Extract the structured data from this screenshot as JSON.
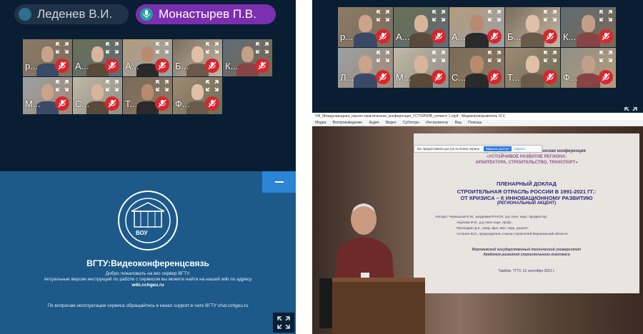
{
  "colors": {
    "panel_bg": "#0a1e33",
    "accent": "#2b84d6",
    "mute": "#d9262e",
    "pill_purple": "#7b2fb0",
    "welcome_bg": "#1d5a8a"
  },
  "speakers": [
    {
      "name": "Леденев В.И.",
      "state": "inactive",
      "icon": "dot-icon"
    },
    {
      "name": "Монастырев П.В.",
      "state": "speaking",
      "icon": "microphone-icon"
    }
  ],
  "left_tiles": [
    "р...",
    "А...",
    "А...",
    "Б...",
    "К...",
    "М...",
    "С...",
    "Т...",
    "Ф..."
  ],
  "right_tiles": [
    "р...",
    "А...",
    "А...",
    "Б...",
    "К...",
    "Л...",
    "М...",
    "С...",
    "Т...",
    "Ф..."
  ],
  "welcome": {
    "logo_top": "Воронежский опорный университет",
    "logo_abbr": "ВОУ",
    "title": "ВГТУ:Видеоконференцсвязь",
    "line1": "Добро пожаловать на вкс сервер ВГТУ.",
    "line2": "Актуальные версии инструкций по работе с сервисом вы можете найти на нашей wiki по адресу",
    "line3": "wiki.cchgeu.ru",
    "support": "По вопросам эксплуатации сервиса обращайтесь в канал support в чате ВГТУ chat.cchgeu.ru"
  },
  "vlc": {
    "title": "VIII_Международная_научно-практическая_конференция_УСТОЙЧИВ_сегмент 1.mp4 - Медиапроигрыватель VLC",
    "menu": [
      "Медиа",
      "Воспроизведение",
      "Аудио",
      "Видео",
      "Субтитры",
      "Инструменты",
      "Вид",
      "Помощь"
    ],
    "notice": "Вы предоставили доступ ко всему экрану",
    "notice_btn": "Закрыть доступ",
    "notice_x": "Скрыть"
  },
  "slide": {
    "l1": "VIII Международная научно-практическая конференция",
    "l2": "«УСТОЙЧИВОЕ РАЗВИТИЕ РЕГИОНА:",
    "l3": "АРХИТЕКТУРА, СТРОИТЕЛЬСТВО, ТРАНСПОРТ»",
    "l4": "ПЛЕНАРНЫЙ ДОКЛАД",
    "l5": "СТРОИТЕЛЬНАЯ ОТРАСЛЬ РОССИИ В 1991-2021 ГГ.:",
    "l6": "ОТ КРИЗИСА – К ИННОВАЦИОННОМУ РАЗВИТИЮ",
    "l7": "(РЕГИОНАЛЬНЫЙ АКЦЕНТ)",
    "a1": "Авторы:  Чернышов Е.М., академик РААСН, д-р техн. наук, профессор;",
    "a2": "Акулова И.И., д-р экон наук, проф.;",
    "a3": "Проскурин Д.К., канд. физ.-мат. наук, доцент;",
    "a4": "Астанин В.И., председатель Союза строителей Воронежской области",
    "u1": "Воронежский государственный технический университет",
    "u2": "Академия развития строительного комплекса",
    "date": "Тамбов, ТГТУ, 21 сентября 2021 г."
  }
}
